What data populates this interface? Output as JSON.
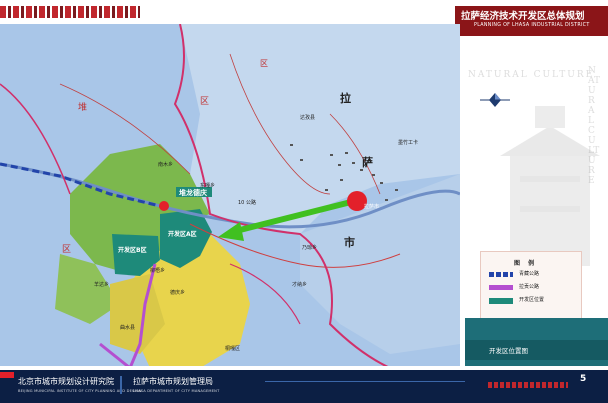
{
  "header": {
    "title_cn": "拉萨经济技术开发区总体规划",
    "title_en": "PLANNING OF LHASA INDUSTRIAL DISTRICT"
  },
  "side_panel": {
    "watermark_horizontal": "NATURAL CULTURE",
    "watermark_vertical": "NATURAL CULTURE",
    "legend": {
      "title": "图 例",
      "items": [
        {
          "label": "青藏公路",
          "color": "#2244aa",
          "style": "dashed"
        },
        {
          "label": "拉贡公路",
          "color": "#b44fd0",
          "style": "solid"
        },
        {
          "label": "开发区位置",
          "color": "#1e8a7a",
          "style": "fill"
        }
      ]
    },
    "caption": "开发区位置图"
  },
  "map": {
    "big_labels": [
      "拉",
      "萨",
      "市"
    ],
    "district_chars": [
      "堆",
      "区",
      "区",
      "区"
    ],
    "place_labels": {
      "duilong": "堆龙德庆",
      "zone_a": "开发区A区",
      "zone_b": "开发区B区",
      "lhasa": "拉萨市",
      "gonglu": "10 公路",
      "liuwu": "柳梧乡",
      "naiqiong": "乃琼乡",
      "dongga": "东嘎乡",
      "nanmu": "南木乡",
      "yangda": "羊达乡",
      "deqing": "德庆乡",
      "quxu": "曲水县",
      "caina": "才纳乡",
      "tongjia": "桐嘎区",
      "mozhu": "墨竹工卡",
      "dazi": "达孜县"
    },
    "colors": {
      "background": "#8aa8d8",
      "land": "#9cc0e4",
      "duilong_region": "#78b64a",
      "south_region": "#e6d34a",
      "zone_fill": "#1e8a7a",
      "arrow": "#40c020",
      "marker": "#e3202a",
      "boundary": "#d1306a"
    }
  },
  "footer": {
    "institute_1_cn": "北京市城市规划设计研究院",
    "institute_1_en": "BEIJING MUNICIPAL INSTITUTE OF CITY PLANNING AND DESIGN",
    "institute_2_cn": "拉萨市城市规划管理局",
    "institute_2_en": "LHASA DEPARTMENT OF CITY MANAGEMENT",
    "page_number": "5"
  }
}
